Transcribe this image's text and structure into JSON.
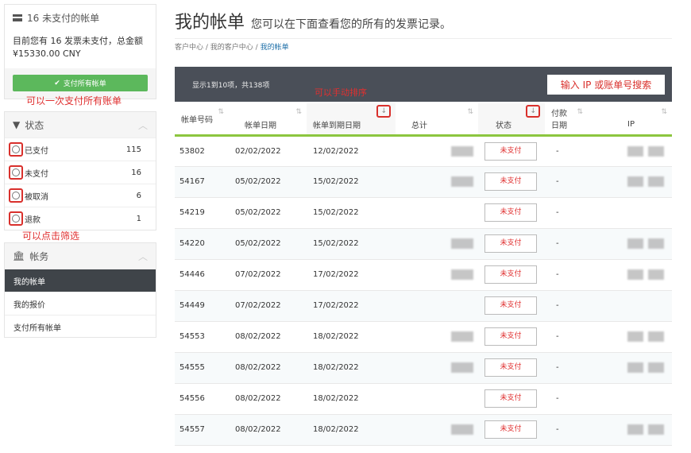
{
  "sidebar": {
    "unpaid": {
      "title": "16 未支付的帐单",
      "text": "目前您有 16 发票未支付，总金额 ¥15330.00 CNY",
      "pay_button": "支付所有帐单",
      "annotation": "可以一次支付所有账单"
    },
    "status": {
      "title": "状态",
      "items": [
        {
          "label": "已支付",
          "count": "115"
        },
        {
          "label": "未支付",
          "count": "16"
        },
        {
          "label": "被取消",
          "count": "6"
        },
        {
          "label": "退款",
          "count": "1"
        }
      ],
      "annotation": "可以点击筛选"
    },
    "billing": {
      "title": "帐务",
      "items": [
        "我的帐单",
        "我的报价",
        "支付所有帐单"
      ]
    }
  },
  "header": {
    "title": "我的帐单",
    "subtitle": "您可以在下面查看您的所有的发票记录。",
    "breadcrumb": [
      "客户中心",
      "我的客户中心",
      "我的帐单"
    ]
  },
  "table": {
    "info": "显示1到10项，共138项",
    "search_placeholder": "输入 IP 或账单号搜索",
    "sort_annotation": "可以手动排序",
    "columns": [
      "帐单号码",
      "帐单日期",
      "帐单到期日期",
      "总计",
      "状态",
      "付款日期",
      "IP"
    ],
    "rows": [
      {
        "id": "53802",
        "date": "02/02/2022",
        "due": "12/02/2022",
        "status": "未支付",
        "paid": "-"
      },
      {
        "id": "54167",
        "date": "05/02/2022",
        "due": "15/02/2022",
        "status": "未支付",
        "paid": "-"
      },
      {
        "id": "54219",
        "date": "05/02/2022",
        "due": "15/02/2022",
        "status": "未支付",
        "paid": "-"
      },
      {
        "id": "54220",
        "date": "05/02/2022",
        "due": "15/02/2022",
        "status": "未支付",
        "paid": "-"
      },
      {
        "id": "54446",
        "date": "07/02/2022",
        "due": "17/02/2022",
        "status": "未支付",
        "paid": "-"
      },
      {
        "id": "54449",
        "date": "07/02/2022",
        "due": "17/02/2022",
        "status": "未支付",
        "paid": "-"
      },
      {
        "id": "54553",
        "date": "08/02/2022",
        "due": "18/02/2022",
        "status": "未支付",
        "paid": "-"
      },
      {
        "id": "54555",
        "date": "08/02/2022",
        "due": "18/02/2022",
        "status": "未支付",
        "paid": "-"
      },
      {
        "id": "54556",
        "date": "08/02/2022",
        "due": "18/02/2022",
        "status": "未支付",
        "paid": "-"
      },
      {
        "id": "54557",
        "date": "08/02/2022",
        "due": "18/02/2022",
        "status": "未支付",
        "paid": "-"
      }
    ]
  },
  "colors": {
    "green": "#5cb85c",
    "dark": "#4a4f58",
    "red": "#e03030",
    "accent_line": "#8cc63f"
  }
}
